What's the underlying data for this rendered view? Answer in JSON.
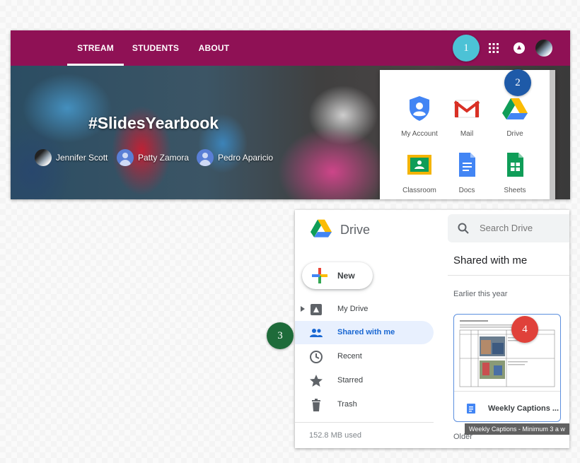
{
  "classroom": {
    "tabs": [
      "STREAM",
      "STUDENTS",
      "ABOUT"
    ],
    "banner_title": "#SlidesYearbook",
    "members": [
      "Jennifer Scott",
      "Patty Zamora",
      "Pedro Aparicio"
    ],
    "theme_color": "#8f1155"
  },
  "apps_menu": {
    "items": [
      "My Account",
      "Mail",
      "Drive",
      "Classroom",
      "Docs",
      "Sheets"
    ]
  },
  "badges": [
    "1",
    "2",
    "3",
    "4"
  ],
  "drive": {
    "title": "Drive",
    "search_placeholder": "Search Drive",
    "new_label": "New",
    "nav": [
      "My Drive",
      "Shared with me",
      "Recent",
      "Starred",
      "Trash"
    ],
    "quota": "152.8 MB used",
    "section_title": "Shared with me",
    "group_earlier": "Earlier this year",
    "group_older": "Older",
    "file_name": "Weekly Captions ...",
    "tooltip": "Weekly Captions - Minimum 3 a w"
  }
}
